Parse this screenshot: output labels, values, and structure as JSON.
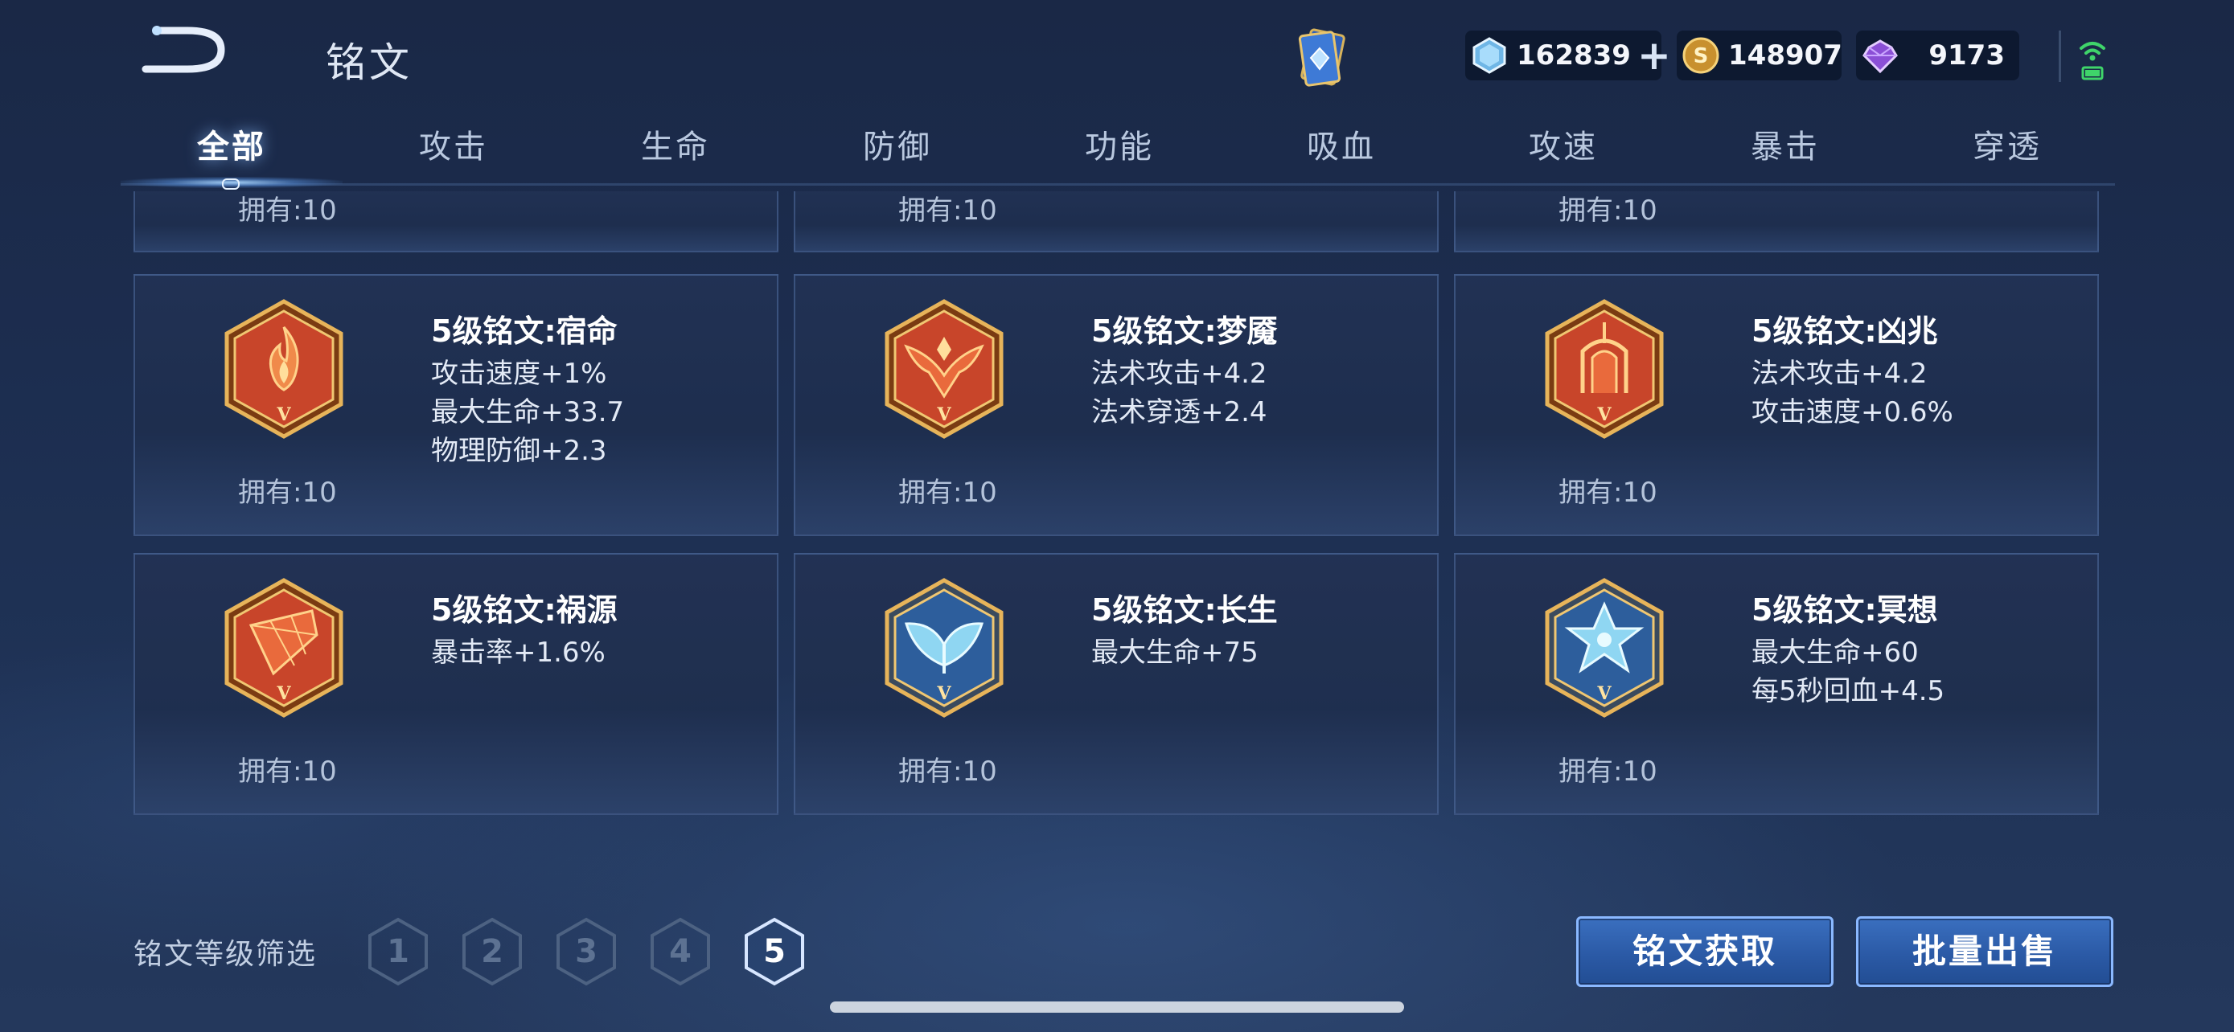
{
  "header": {
    "title": "铭文",
    "currencies": {
      "diamond": "162839",
      "gold": "148907",
      "gem": "9173"
    }
  },
  "tabs": [
    "全部",
    "攻击",
    "生命",
    "防御",
    "功能",
    "吸血",
    "攻速",
    "暴击",
    "穿透"
  ],
  "partial_row": {
    "own": "拥有:10"
  },
  "runes": [
    {
      "title": "5级铭文:宿命",
      "attrs": [
        "攻击速度+1%",
        "最大生命+33.7",
        "物理防御+2.3"
      ],
      "own": "拥有:10",
      "color": "red",
      "icon": "flame-rune-icon"
    },
    {
      "title": "5级铭文:梦魇",
      "attrs": [
        "法术攻击+4.2",
        "法术穿透+2.4"
      ],
      "own": "拥有:10",
      "color": "red",
      "icon": "winged-rune-icon"
    },
    {
      "title": "5级铭文:凶兆",
      "attrs": [
        "法术攻击+4.2",
        "攻击速度+0.6%"
      ],
      "own": "拥有:10",
      "color": "red",
      "icon": "gate-rune-icon"
    },
    {
      "title": "5级铭文:祸源",
      "attrs": [
        "暴击率+1.6%"
      ],
      "own": "拥有:10",
      "color": "red",
      "icon": "shard-rune-icon"
    },
    {
      "title": "5级铭文:长生",
      "attrs": [
        "最大生命+75"
      ],
      "own": "拥有:10",
      "color": "blue",
      "icon": "leaf-rune-icon"
    },
    {
      "title": "5级铭文:冥想",
      "attrs": [
        "最大生命+60",
        "每5秒回血+4.5"
      ],
      "own": "拥有:10",
      "color": "blue",
      "icon": "crystal-rune-icon"
    }
  ],
  "rune_level_roman": "V",
  "filter": {
    "label": "铭文等级筛选",
    "levels": [
      "1",
      "2",
      "3",
      "4",
      "5"
    ],
    "selected": "5"
  },
  "buttons": {
    "acquire": "铭文获取",
    "bulk_sell": "批量出售"
  },
  "colors": {
    "red_rune": "#c8452a",
    "blue_rune": "#2d5e9c",
    "gold_rim": "#d9a24c",
    "button": "#2e5fae"
  }
}
